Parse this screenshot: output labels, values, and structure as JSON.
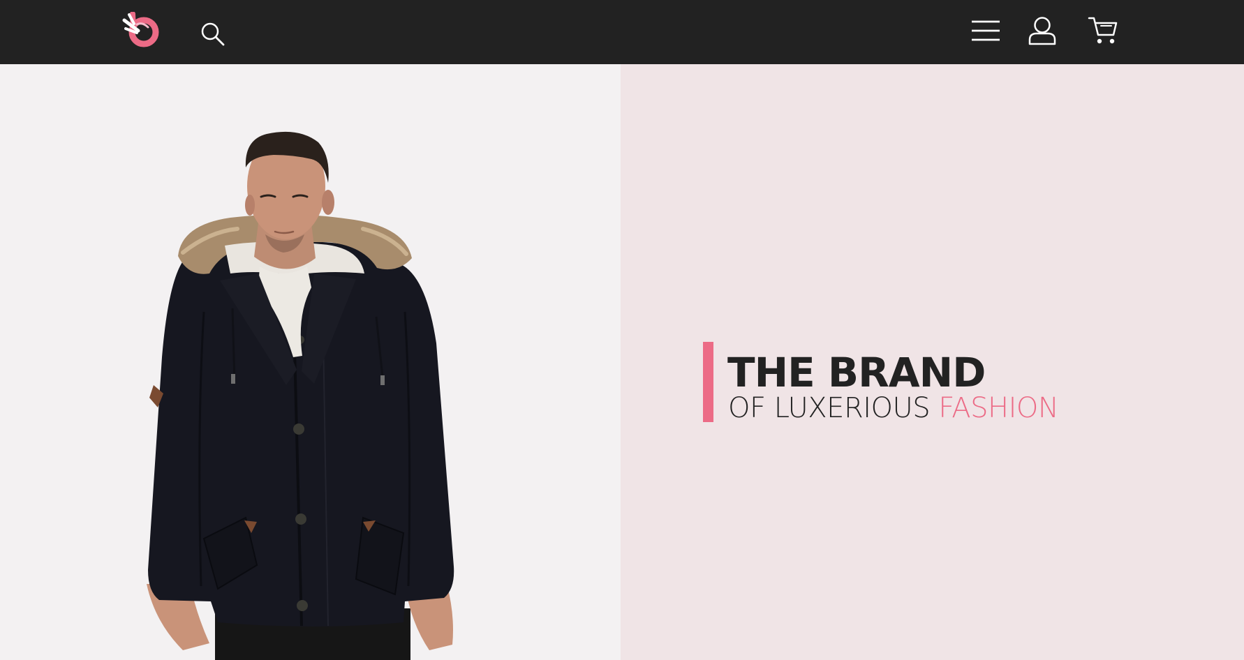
{
  "header": {
    "logo_icon": "brand-logo-icon",
    "search_icon": "search-icon",
    "menu_icon": "hamburger-menu-icon",
    "account_icon": "user-account-icon",
    "cart_icon": "shopping-cart-icon"
  },
  "hero": {
    "title": "THE BRAND",
    "subtitle_prefix": "OF LUXERIOUS ",
    "subtitle_accent": "FASHION",
    "product_image": "man-in-navy-parka-with-fur-hood"
  },
  "colors": {
    "topbar": "#222222",
    "accent": "#ec6b86",
    "left_background": "#f3f1f2",
    "right_background": "#f0e4e6",
    "text": "#222222"
  }
}
